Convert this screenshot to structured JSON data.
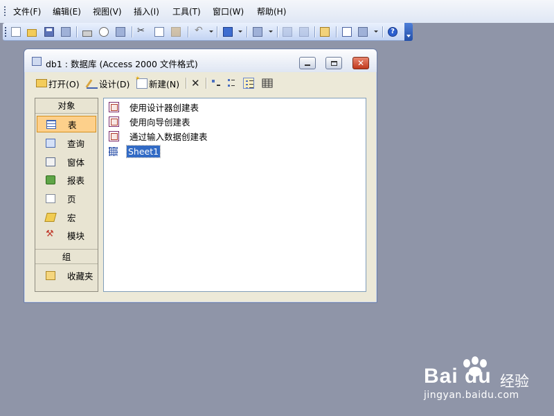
{
  "menubar": {
    "items": [
      "文件(F)",
      "编辑(E)",
      "视图(V)",
      "插入(I)",
      "工具(T)",
      "窗口(W)",
      "帮助(H)"
    ]
  },
  "toolbar": {
    "buttons": [
      "new-icon",
      "open-icon",
      "save-icon",
      "file-search-icon",
      "print-icon",
      "print-preview-icon",
      "spelling-icon",
      "cut-icon",
      "copy-icon",
      "paste-icon",
      "undo-icon",
      "office-links-icon",
      "analyze-icon",
      "code-icon",
      "script-icon",
      "properties-icon",
      "relationships-icon",
      "new-object-icon",
      "help-icon"
    ]
  },
  "db_window": {
    "title": "db1 : 数据库 (Access 2000 文件格式)",
    "toolbar": {
      "open_label": "打开(O)",
      "design_label": "设计(D)",
      "new_label": "新建(N)"
    },
    "objects_header": "对象",
    "groups_header": "组",
    "objects": [
      "表",
      "查询",
      "窗体",
      "报表",
      "页",
      "宏",
      "模块"
    ],
    "groups": [
      "收藏夹"
    ],
    "selected_object": "表",
    "list_items": [
      "使用设计器创建表",
      "使用向导创建表",
      "通过输入数据创建表",
      "Sheet1"
    ],
    "selected_list_item": "Sheet1"
  },
  "watermark": {
    "logo": "Bai du",
    "brand_text": "经验",
    "url": "jingyan.baidu.com"
  },
  "colors": {
    "desktop": "#8f95a8",
    "selection": "#316ac5",
    "object_selected": "#fdd08b",
    "close_button": "#c0391c"
  }
}
